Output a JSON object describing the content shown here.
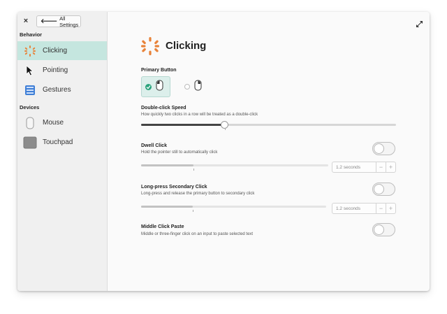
{
  "window": {
    "close_label": "×",
    "expand_icon": "expand-icon"
  },
  "sidebar": {
    "all_settings_label": "All Settings",
    "sections": [
      {
        "label": "Behavior"
      },
      {
        "label": "Devices"
      }
    ],
    "items": [
      {
        "label": "Clicking",
        "icon": "clicking-icon",
        "active": true
      },
      {
        "label": "Pointing",
        "icon": "pointer-icon",
        "active": false
      },
      {
        "label": "Gestures",
        "icon": "gestures-icon",
        "active": false
      },
      {
        "label": "Mouse",
        "icon": "mouse-icon",
        "active": false
      },
      {
        "label": "Touchpad",
        "icon": "touchpad-icon",
        "active": false
      }
    ]
  },
  "page": {
    "title": "Clicking",
    "primary_button": {
      "label": "Primary Button",
      "options": [
        {
          "name": "left",
          "selected": true
        },
        {
          "name": "right",
          "selected": false
        }
      ]
    },
    "double_click": {
      "label": "Double-click Speed",
      "description": "How quickly two clicks in a row will be treated as a double-click",
      "value_fraction": 0.33
    },
    "dwell_click": {
      "label": "Dwell Click",
      "description": "Hold the pointer still to automatically click",
      "enabled": false,
      "value_fraction": 0.28,
      "spin_value": "1.2 seconds",
      "minus": "−",
      "plus": "+"
    },
    "long_press": {
      "label": "Long-press Secondary Click",
      "description": "Long-press and release the primary button to secondary click",
      "enabled": false,
      "value_fraction": 0.28,
      "spin_value": "1.2 seconds",
      "minus": "−",
      "plus": "+"
    },
    "middle_click": {
      "label": "Middle Click Paste",
      "description": "Middle or three-finger click on an input to paste selected text",
      "enabled": false
    }
  },
  "colors": {
    "accent": "#2aa37c",
    "active_bg": "#c5e6df",
    "clicking_icon": "#e8833a"
  }
}
